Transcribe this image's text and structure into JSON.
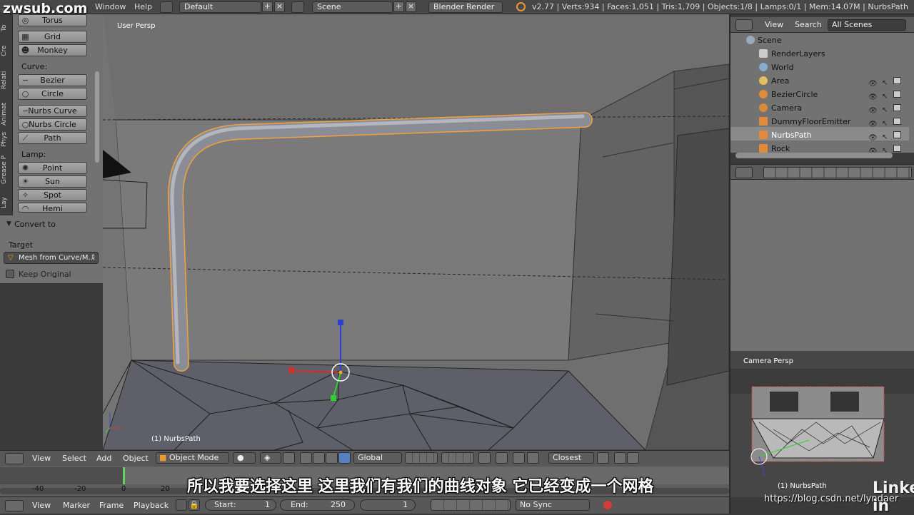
{
  "watermark": {
    "top": "zwsub.com",
    "bottom": "https://blog.csdn.net/lyndaer",
    "brand": "Linked in"
  },
  "topbar": {
    "menus": [
      "Window",
      "Help"
    ],
    "layout": "Default",
    "scene": "Scene",
    "engine": "Blender Render",
    "stats": "v2.77 | Verts:934 | Faces:1,051 | Tris:1,709 | Objects:1/8 | Lamps:0/1 | Mem:14.07M | NurbsPath"
  },
  "tool_tabs": [
    "To",
    "Cre",
    "Relati",
    "Animat",
    "Phys",
    "Grease P",
    "Lay"
  ],
  "tool_shelf": {
    "mesh_buttons": [
      {
        "label": "Torus",
        "icon": "torus-icon"
      },
      {
        "label": "Grid",
        "icon": "grid-icon"
      },
      {
        "label": "Monkey",
        "icon": "monkey-icon"
      }
    ],
    "curve_label": "Curve:",
    "curve_buttons": [
      {
        "label": "Bezier",
        "icon": "bezier-icon"
      },
      {
        "label": "Circle",
        "icon": "circle-icon"
      },
      {
        "label": "Nurbs Curve",
        "icon": "nurbs-curve-icon"
      },
      {
        "label": "Nurbs Circle",
        "icon": "nurbs-circle-icon"
      },
      {
        "label": "Path",
        "icon": "path-icon"
      }
    ],
    "lamp_label": "Lamp:",
    "lamp_buttons": [
      {
        "label": "Point",
        "icon": "point-lamp-icon"
      },
      {
        "label": "Sun",
        "icon": "sun-icon"
      },
      {
        "label": "Spot",
        "icon": "spot-icon"
      },
      {
        "label": "Hemi",
        "icon": "hemi-icon"
      }
    ]
  },
  "operator": {
    "title": "Convert to",
    "target_label": "Target",
    "target_value": "Mesh from Curve/M...",
    "keep_original": "Keep Original"
  },
  "viewport": {
    "view_label": "User Persp",
    "object_label": "(1) NurbsPath",
    "path_highlight": "#f5a13a",
    "background": "#6f6f6f"
  },
  "outliner": {
    "menus": [
      "View",
      "Search"
    ],
    "filter": "All Scenes",
    "items": [
      {
        "name": "Scene",
        "indent": 0
      },
      {
        "name": "RenderLayers",
        "indent": 1
      },
      {
        "name": "World",
        "indent": 1
      },
      {
        "name": "Area",
        "indent": 1
      },
      {
        "name": "BezierCircle",
        "indent": 1
      },
      {
        "name": "Camera",
        "indent": 1
      },
      {
        "name": "DummyFloorEmitter",
        "indent": 1
      },
      {
        "name": "NurbsPath",
        "indent": 1
      },
      {
        "name": "Rock",
        "indent": 1
      }
    ]
  },
  "camera_preview": {
    "label": "Camera Persp",
    "object_label": "(1) NurbsPath"
  },
  "view3d_header": {
    "menus": [
      "View",
      "Select",
      "Add",
      "Object"
    ],
    "mode": "Object Mode",
    "orientation": "Global",
    "snap": "Closest"
  },
  "timeline": {
    "ticks": [
      "-40",
      "-20",
      "0",
      "20"
    ],
    "menus": [
      "View",
      "Marker",
      "Frame",
      "Playback"
    ],
    "start_label": "Start:",
    "start_value": "1",
    "end_label": "End:",
    "end_value": "250",
    "current": "1",
    "sync": "No Sync"
  },
  "subtitle": "所以我要选择这里  这里我们有我们的曲线对象  它已经变成一个网格"
}
